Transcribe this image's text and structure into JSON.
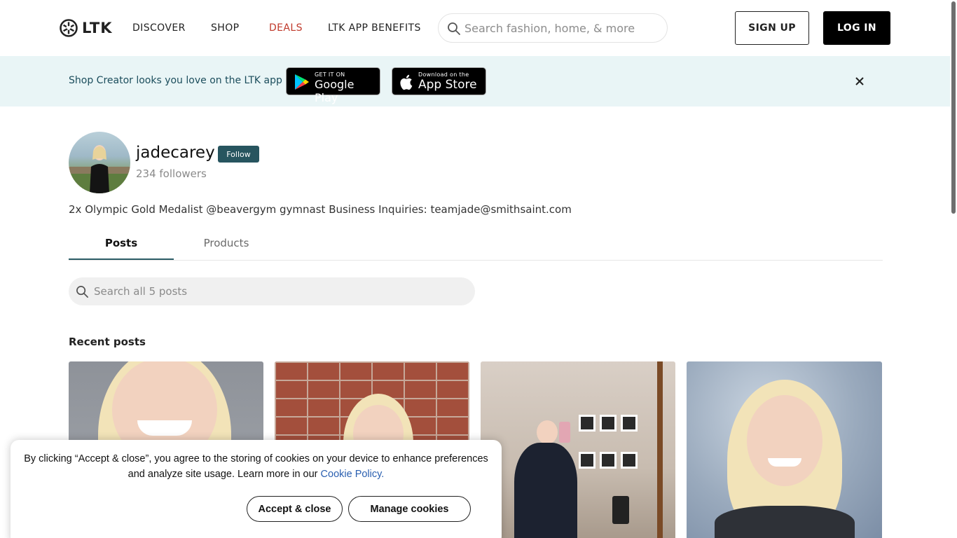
{
  "header": {
    "logo_text": "LTK",
    "nav": [
      {
        "label": "DISCOVER"
      },
      {
        "label": "SHOP"
      },
      {
        "label": "DEALS"
      },
      {
        "label": "LTK APP BENEFITS"
      }
    ],
    "search_placeholder": "Search fashion, home, & more",
    "signup_label": "SIGN UP",
    "login_label": "LOG IN"
  },
  "banner": {
    "text": "Shop Creator looks you love on the LTK app",
    "google_small": "GET IT ON",
    "google_big": "Google Play",
    "apple_small": "Download on the",
    "apple_big": "App Store"
  },
  "profile": {
    "username": "jadecarey",
    "follow_label": "Follow",
    "followers": "234 followers",
    "bio": "2x Olympic Gold Medalist @beavergym gymnast Business Inquiries: teamjade@smithsaint.com"
  },
  "tabs": [
    {
      "label": "Posts"
    },
    {
      "label": "Products"
    }
  ],
  "post_search_placeholder": "Search all 5 posts",
  "recent_title": "Recent posts",
  "cookie": {
    "text": "By clicking “Accept & close”, you agree to the storing of cookies on your device to enhance preferences and analyze site usage. Learn more in our",
    "link": "Cookie Policy.",
    "accept_label": "Accept & close",
    "manage_label": "Manage cookies"
  },
  "colors": {
    "deals": "#c0392b",
    "banner_bg": "#e9f5f6",
    "follow_bg": "#27555f",
    "tab_underline": "#2b5d66"
  }
}
